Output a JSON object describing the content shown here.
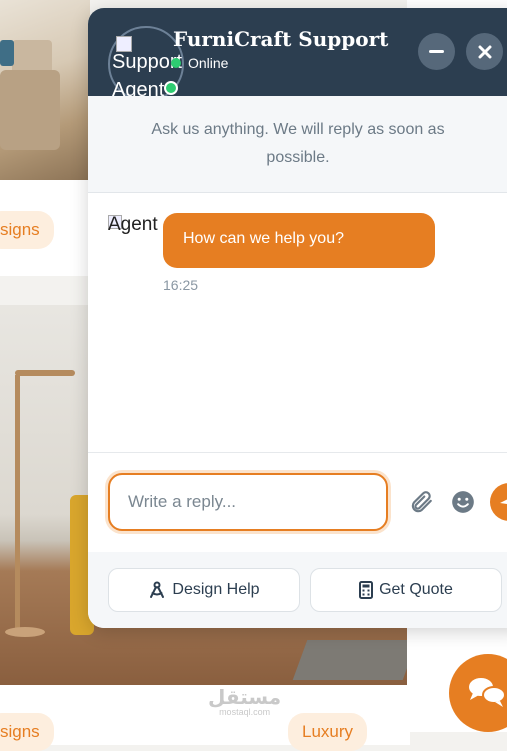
{
  "background": {
    "tags": [
      "signs",
      "signs",
      "Luxury"
    ],
    "watermark": {
      "arabic": "مستقل",
      "latin": "mostaql.com"
    }
  },
  "chat": {
    "header": {
      "avatar_alt": "Support Agent",
      "title": "FurniCraft Support",
      "status": "Online"
    },
    "intro": "Ask us anything. We will reply as soon as possible.",
    "messages": [
      {
        "sender_alt": "Agent",
        "text": "How can we help you?",
        "time": "16:25"
      }
    ],
    "input": {
      "placeholder": "Write a reply...",
      "value": ""
    },
    "quick_actions": [
      {
        "label": "Design Help",
        "icon": "compass-icon"
      },
      {
        "label": "Get Quote",
        "icon": "calculator-icon"
      }
    ]
  },
  "colors": {
    "accent": "#e67e22",
    "header": "#2c3e50",
    "online": "#2ecc71"
  }
}
